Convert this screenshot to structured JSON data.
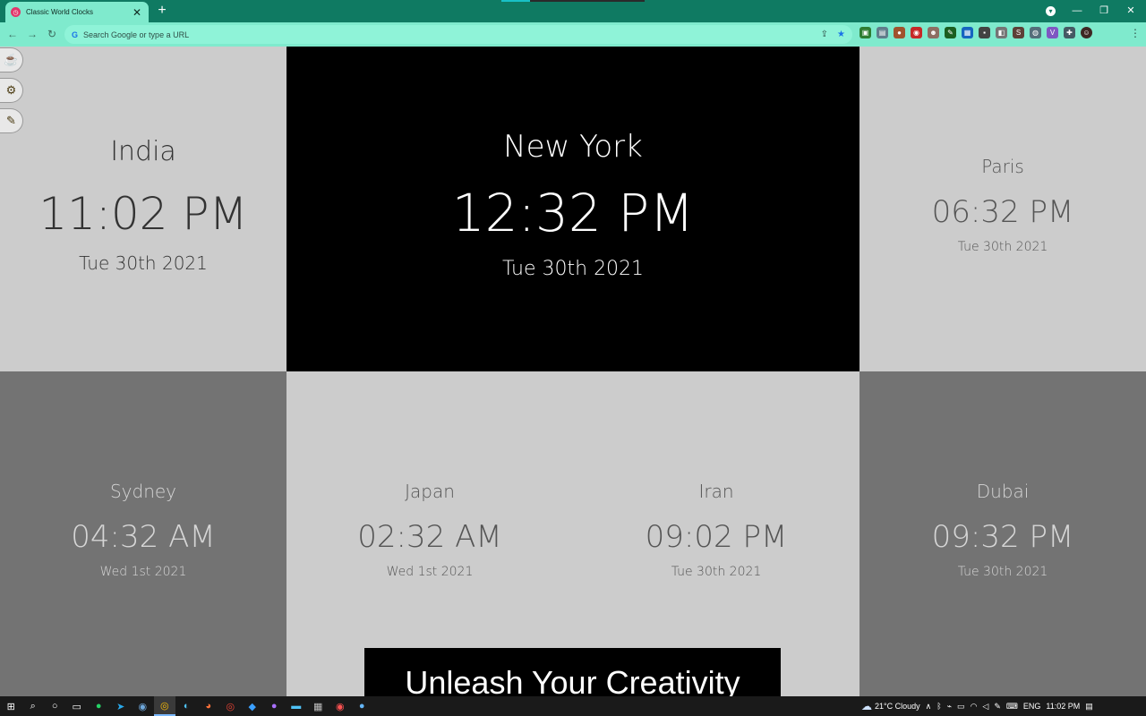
{
  "browser": {
    "tab_title": "Classic World Clocks",
    "tab_close": "✕",
    "new_tab": "+",
    "omnibox_placeholder": "Search Google or type a URL",
    "window_controls": {
      "minimize": "—",
      "restore": "❐",
      "close": "✕"
    }
  },
  "clocks": [
    {
      "city": "India",
      "time": "11:02 PM",
      "date": "Tue 30th 2021"
    },
    {
      "city": "New York",
      "time": "12:32 PM",
      "date": "Tue 30th 2021"
    },
    {
      "city": "Paris",
      "time": "06:32 PM",
      "date": "Tue 30th 2021"
    },
    {
      "city": "Sydney",
      "time": "04:32 AM",
      "date": "Wed 1st 2021"
    },
    {
      "city": "Japan",
      "time": "02:32 AM",
      "date": "Wed 1st 2021"
    },
    {
      "city": "Iran",
      "time": "09:02 PM",
      "date": "Tue 30th 2021"
    },
    {
      "city": "Dubai",
      "time": "09:32 PM",
      "date": "Tue 30th 2021"
    }
  ],
  "banner": {
    "text": "Unleash Your Creativity"
  },
  "taskbar": {
    "weather": "21°C Cloudy",
    "language": "ENG",
    "clock": "11:02 PM"
  },
  "icons": {
    "side_buttons": [
      "cup-icon",
      "gear-icon",
      "pencil-icon"
    ]
  },
  "colors": {
    "tab_bar": "#0f7a62",
    "toolbar": "#7feacd",
    "highlight_tile": "#000000",
    "light_tile": "#cccccc",
    "dark_tile": "#737373"
  }
}
